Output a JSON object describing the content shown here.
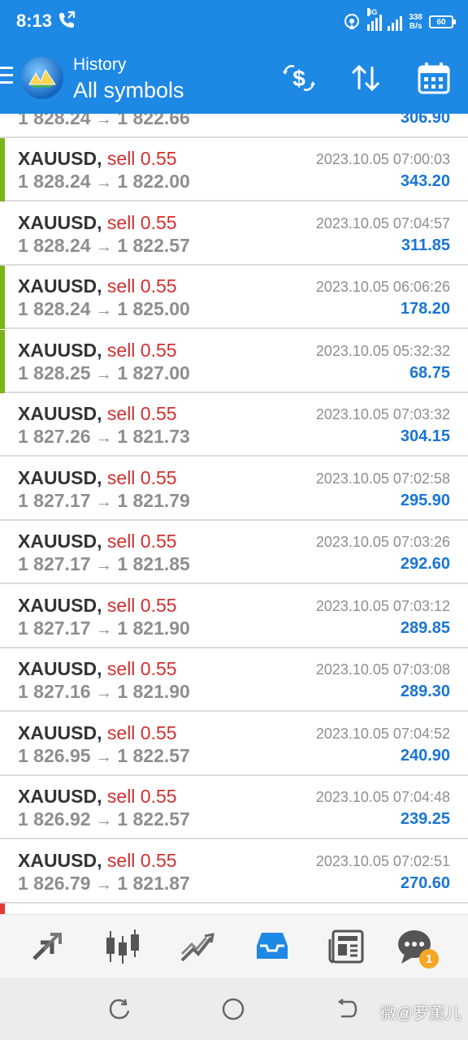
{
  "status_bar": {
    "time": "8:13",
    "network": "4G",
    "speed_value": "338",
    "speed_unit": "B/s",
    "battery": "60"
  },
  "app_bar": {
    "subtitle": "History",
    "title": "All symbols"
  },
  "colors": {
    "primary": "#1e88e5",
    "sell": "#d32f2f",
    "profit": "#1976d2",
    "accent_bar": "#7cb518",
    "badge": "#f5a623"
  },
  "trades_partial": {
    "open_price": "1 828.24",
    "close_price": "1 822.66",
    "profit": "306.90"
  },
  "trades": [
    {
      "symbol": "XAUUSD,",
      "side": "sell 0.55",
      "open_price": "1 828.24",
      "close_price": "1 822.00",
      "time": "2023.10.05 07:00:03",
      "profit": "343.20",
      "accent": true
    },
    {
      "symbol": "XAUUSD,",
      "side": "sell 0.55",
      "open_price": "1 828.24",
      "close_price": "1 822.57",
      "time": "2023.10.05 07:04:57",
      "profit": "311.85",
      "accent": false
    },
    {
      "symbol": "XAUUSD,",
      "side": "sell 0.55",
      "open_price": "1 828.24",
      "close_price": "1 825.00",
      "time": "2023.10.05 06:06:26",
      "profit": "178.20",
      "accent": true
    },
    {
      "symbol": "XAUUSD,",
      "side": "sell 0.55",
      "open_price": "1 828.25",
      "close_price": "1 827.00",
      "time": "2023.10.05 05:32:32",
      "profit": "68.75",
      "accent": true
    },
    {
      "symbol": "XAUUSD,",
      "side": "sell 0.55",
      "open_price": "1 827.26",
      "close_price": "1 821.73",
      "time": "2023.10.05 07:03:32",
      "profit": "304.15",
      "accent": false
    },
    {
      "symbol": "XAUUSD,",
      "side": "sell 0.55",
      "open_price": "1 827.17",
      "close_price": "1 821.79",
      "time": "2023.10.05 07:02:58",
      "profit": "295.90",
      "accent": false
    },
    {
      "symbol": "XAUUSD,",
      "side": "sell 0.55",
      "open_price": "1 827.17",
      "close_price": "1 821.85",
      "time": "2023.10.05 07:03:26",
      "profit": "292.60",
      "accent": false
    },
    {
      "symbol": "XAUUSD,",
      "side": "sell 0.55",
      "open_price": "1 827.17",
      "close_price": "1 821.90",
      "time": "2023.10.05 07:03:12",
      "profit": "289.85",
      "accent": false
    },
    {
      "symbol": "XAUUSD,",
      "side": "sell 0.55",
      "open_price": "1 827.16",
      "close_price": "1 821.90",
      "time": "2023.10.05 07:03:08",
      "profit": "289.30",
      "accent": false
    },
    {
      "symbol": "XAUUSD,",
      "side": "sell 0.55",
      "open_price": "1 826.95",
      "close_price": "1 822.57",
      "time": "2023.10.05 07:04:52",
      "profit": "240.90",
      "accent": false
    },
    {
      "symbol": "XAUUSD,",
      "side": "sell 0.55",
      "open_price": "1 826.92",
      "close_price": "1 822.57",
      "time": "2023.10.05 07:04:48",
      "profit": "239.25",
      "accent": false
    },
    {
      "symbol": "XAUUSD,",
      "side": "sell 0.55",
      "open_price": "1 826.79",
      "close_price": "1 821.87",
      "time": "2023.10.05 07:02:51",
      "profit": "270.60",
      "accent": false
    }
  ],
  "arrow_glyph": "→",
  "tabs": [
    {
      "name": "quotes-tab",
      "icon": "quotes-arrows-icon"
    },
    {
      "name": "chart-tab",
      "icon": "candlestick-icon"
    },
    {
      "name": "trade-tab",
      "icon": "trade-chart-icon"
    },
    {
      "name": "history-tab",
      "icon": "inbox-icon",
      "active": true
    },
    {
      "name": "news-tab",
      "icon": "newspaper-icon"
    },
    {
      "name": "messages-tab",
      "icon": "chat-bubble-icon",
      "badge": "1"
    }
  ],
  "watermark": "微@罗薫儿"
}
